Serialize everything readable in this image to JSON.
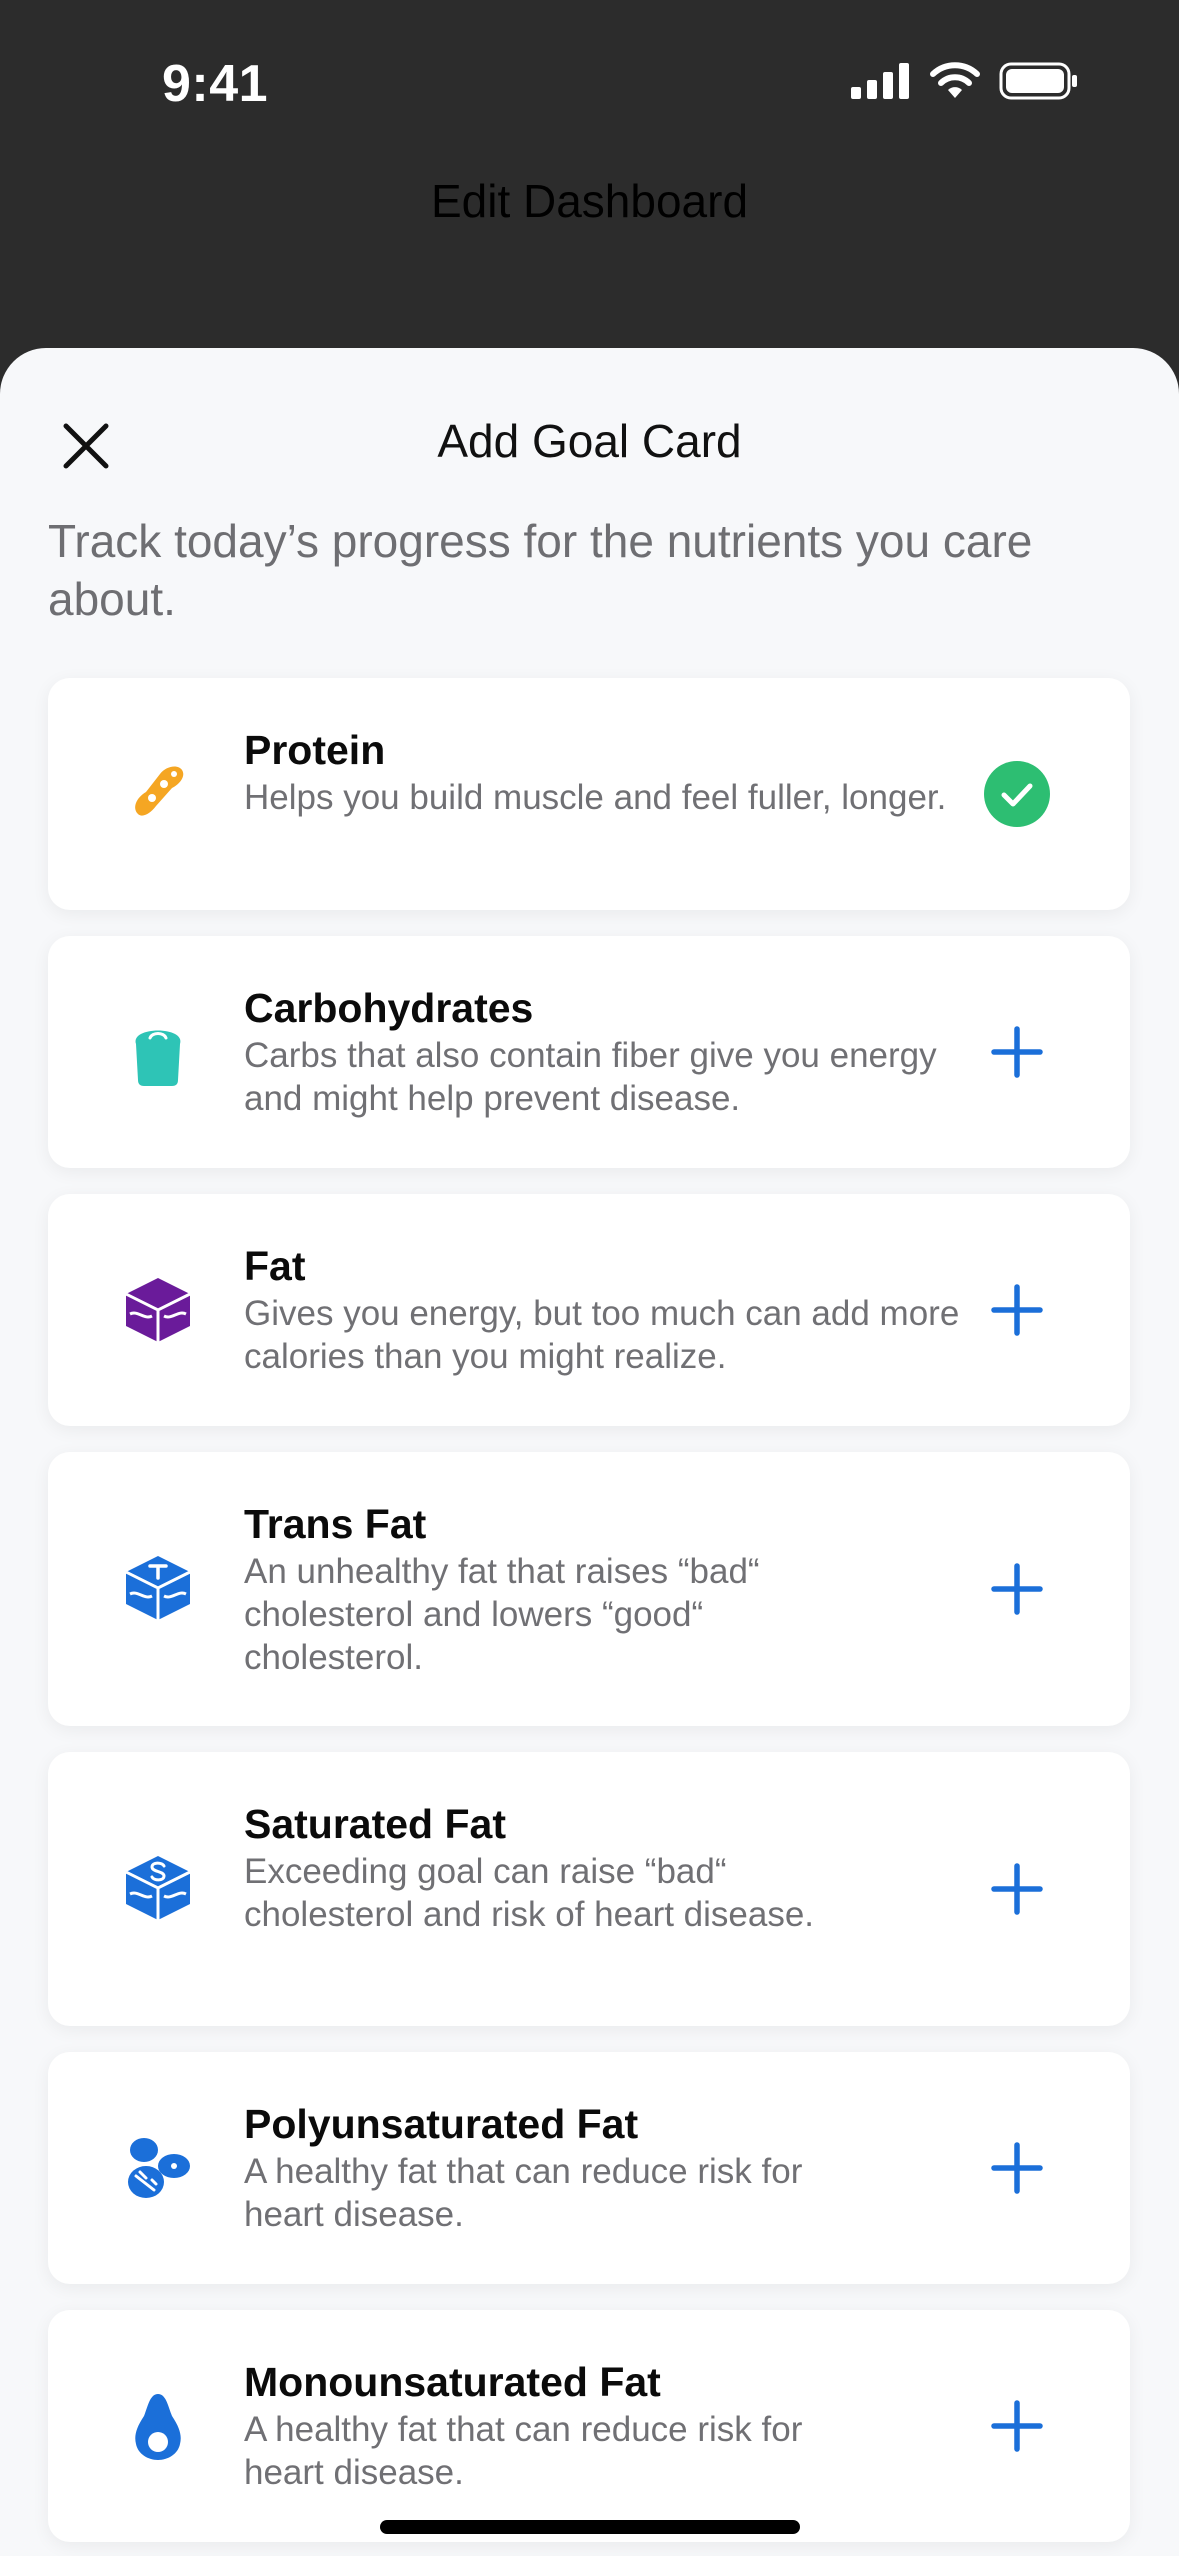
{
  "status_bar": {
    "time": "9:41",
    "icons": [
      "signal-icon",
      "wifi-icon",
      "battery-icon"
    ]
  },
  "background": {
    "title": "Edit Dashboard"
  },
  "sheet": {
    "title": "Add Goal Card",
    "close_icon": "close-icon",
    "subtitle": "Track today’s progress for the nutrients you care about."
  },
  "cards": [
    {
      "title": "Protein",
      "desc": "Helps you build muscle and feel fuller, longer.",
      "icon": "protein-icon",
      "state": "added",
      "color": "#F5A623"
    },
    {
      "title": "Carbohydrates",
      "desc": "Carbs that also contain fiber give you energy and might help prevent disease.",
      "icon": "bread-icon",
      "state": "add",
      "color": "#2EC4B6"
    },
    {
      "title": "Fat",
      "desc": "Gives you energy, but too much can add more calories than you might realize.",
      "icon": "fat-cube-icon",
      "state": "add",
      "color": "#6A1B9A"
    },
    {
      "title": "Trans Fat",
      "desc": "An unhealthy fat that raises “bad“ cholesterol and lowers “good“ cholesterol.",
      "icon": "trans-fat-cube-icon",
      "state": "add",
      "color": "#1B6FD9"
    },
    {
      "title": "Saturated Fat",
      "desc": "Exceeding goal can raise “bad“ cholesterol and risk of heart disease.",
      "icon": "saturated-fat-cube-icon",
      "state": "add",
      "color": "#1B6FD9"
    },
    {
      "title": "Polyunsaturated Fat",
      "desc": "A healthy fat that can reduce risk for heart disease.",
      "icon": "nuts-icon",
      "state": "add",
      "color": "#1B6FD9"
    },
    {
      "title": "Monounsaturated Fat",
      "desc": "A healthy fat that can reduce risk for heart disease.",
      "icon": "avocado-icon",
      "state": "add",
      "color": "#1B6FD9"
    }
  ],
  "colors": {
    "accent": "#1B6FD9",
    "check": "#2DBE72"
  }
}
